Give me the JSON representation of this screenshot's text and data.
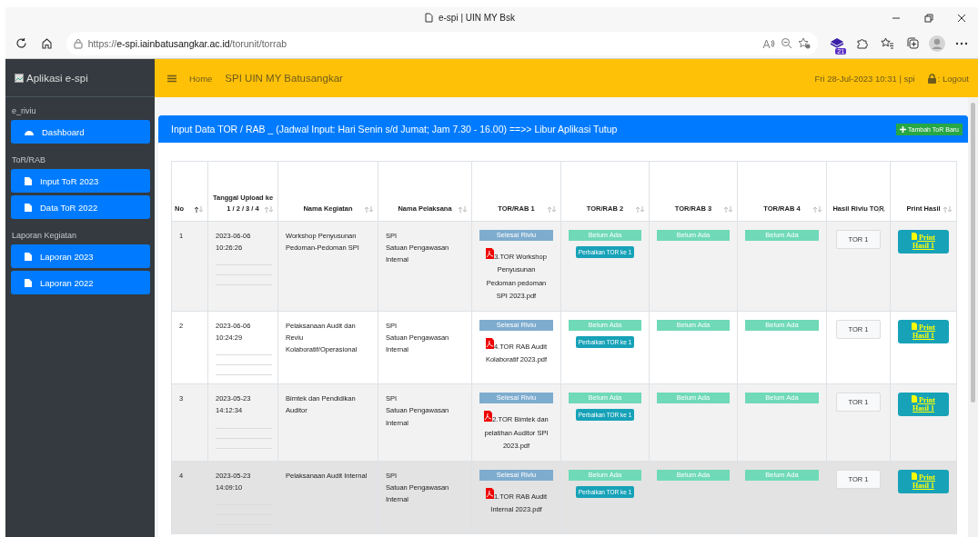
{
  "browser": {
    "tab_title": "e-spi | UIN MY Bsk",
    "url_host": "e-spi.iainbatusangkar.ac.id",
    "url_scheme": "https://",
    "url_path": "/torunit/torrab",
    "extension_badge": "21"
  },
  "sidebar": {
    "brand": "Aplikasi e-spi",
    "sections": [
      {
        "header": "e_riviu",
        "items": [
          {
            "label": "Dashboard",
            "kind": "dashboard"
          }
        ]
      },
      {
        "header": "ToR/RAB",
        "items": [
          {
            "label": "Input ToR 2023",
            "kind": "doc"
          },
          {
            "label": "Data ToR 2022",
            "kind": "doc"
          }
        ]
      },
      {
        "header": "Laporan Kegiatan",
        "items": [
          {
            "label": "Laporan 2023",
            "kind": "doc"
          },
          {
            "label": "Laporan 2022",
            "kind": "doc"
          }
        ]
      }
    ]
  },
  "navbar": {
    "home": "Home",
    "title": "SPI UIN MY Batusangkar",
    "datetime": "Fri 28-Jul-2023 10:31 | spi",
    "logout": ": Logout"
  },
  "card": {
    "title": "Input Data TOR / RAB _ (Jadwal Input: Hari Senin s/d Jumat; Jam 7.30 - 16.00) ==>> Libur Aplikasi Tutup",
    "add_button": "Tambah ToR Baru"
  },
  "table": {
    "columns": [
      {
        "label": "No",
        "sorted": true
      },
      {
        "label": "Tanggal Upload ke 1 / 2 / 3 / 4",
        "sorted": false
      },
      {
        "label": "Nama Kegiatan",
        "sorted": false
      },
      {
        "label": "Nama Pelaksana",
        "sorted": false
      },
      {
        "label": "TOR/RAB 1",
        "sorted": false
      },
      {
        "label": "TOR/RAB 2",
        "sorted": false
      },
      {
        "label": "TOR/RAB 3",
        "sorted": false
      },
      {
        "label": "TOR/RAB 4",
        "sorted": false
      },
      {
        "label": "Hasil Riviu TOR",
        "sorted": false
      },
      {
        "label": "Print Hasil",
        "sorted": false
      }
    ],
    "rows": [
      {
        "no": "1",
        "date": "2023-06-06",
        "time": "10:26:26",
        "kegiatan": "Workshop Penyusunan Pedoman-Pedoman SPI",
        "unit_code": "SPI",
        "unit_name": "Satuan Pengawasan Internal",
        "tor1": {
          "status": "Selesai Riviu",
          "kind": "done",
          "file": "3.TOR Workshop Penyusunan Pedoman pedoman SPI 2023.pdf"
        },
        "tor2": {
          "status": "Belum Ada",
          "kind": "empty",
          "fix_button": "Perbaikan TOR ke 1"
        },
        "tor3": {
          "status": "Belum Ada",
          "kind": "empty"
        },
        "tor4": {
          "status": "Belum Ada",
          "kind": "empty"
        },
        "hasil": "TOR 1",
        "print": "Print Hasil 1",
        "hovered": false
      },
      {
        "no": "2",
        "date": "2023-06-06",
        "time": "10:24:29",
        "kegiatan": "Pelaksanaan Audit dan Reviu Kolaboratif/Operasional",
        "unit_code": "SPI",
        "unit_name": "Satuan Pengawasan Internal",
        "tor1": {
          "status": "Selesai Riviu",
          "kind": "done",
          "file": "4.TOR RAB Audit Kolaboratif 2023.pdf"
        },
        "tor2": {
          "status": "Belum Ada",
          "kind": "empty",
          "fix_button": "Perbaikan TOR ke 1"
        },
        "tor3": {
          "status": "Belum Ada",
          "kind": "empty"
        },
        "tor4": {
          "status": "Belum Ada",
          "kind": "empty"
        },
        "hasil": "TOR 1",
        "print": "Print Hasil 1",
        "hovered": false
      },
      {
        "no": "3",
        "date": "2023-05-23",
        "time": "14:12:34",
        "kegiatan": "Bimtek dan Pendidikan Auditor",
        "unit_code": "SPI",
        "unit_name": "Satuan Pengawasan Internal",
        "tor1": {
          "status": "Selesai Riviu",
          "kind": "done",
          "file": "2.TOR Bimtek dan pelatihan Auditor SPI 2023.pdf"
        },
        "tor2": {
          "status": "Belum Ada",
          "kind": "empty",
          "fix_button": "Perbaikan TOR ke 1"
        },
        "tor3": {
          "status": "Belum Ada",
          "kind": "empty"
        },
        "tor4": {
          "status": "Belum Ada",
          "kind": "empty"
        },
        "hasil": "TOR 1",
        "print": "Print Hasil 1",
        "hovered": false
      },
      {
        "no": "4",
        "date": "2023-05-23",
        "time": "14:09:10",
        "kegiatan": "Pelaksanaan Audit Internal",
        "unit_code": "SPI",
        "unit_name": "Satuan Pengawasan Internal",
        "tor1": {
          "status": "Selesai Riviu",
          "kind": "done",
          "file": "1.TOR RAB Audit Internal 2023.pdf"
        },
        "tor2": {
          "status": "Belum Ada",
          "kind": "empty",
          "fix_button": "Perbaikan TOR ke 1"
        },
        "tor3": {
          "status": "Belum Ada",
          "kind": "empty"
        },
        "tor4": {
          "status": "Belum Ada",
          "kind": "empty"
        },
        "hasil": "TOR 1",
        "print": "Print Hasil 1",
        "hovered": true
      }
    ]
  }
}
